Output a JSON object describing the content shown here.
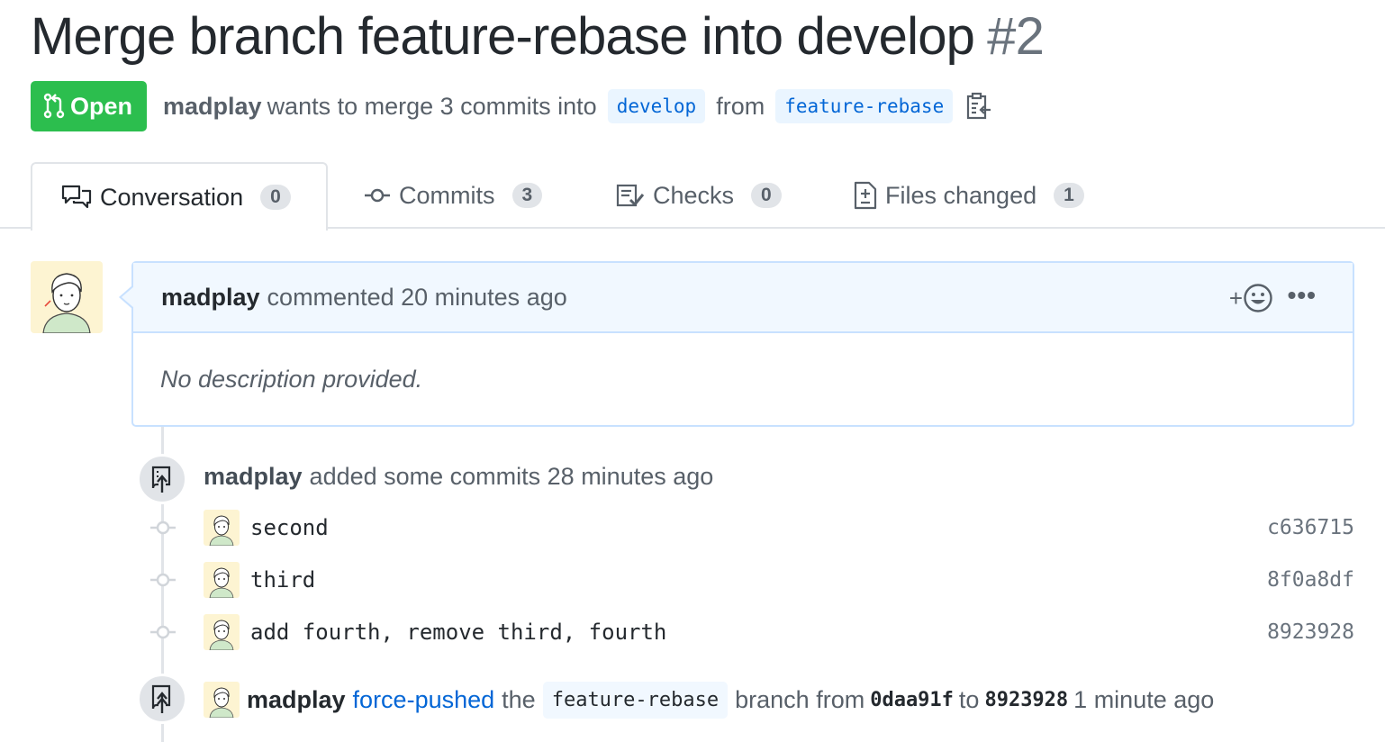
{
  "pr": {
    "title": "Merge branch feature-rebase into develop",
    "number": "#2",
    "state": "Open",
    "author": "madplay",
    "merge_text_1": "wants to merge 3 commits into",
    "base_branch": "develop",
    "merge_text_2": "from",
    "head_branch": "feature-rebase"
  },
  "tabs": [
    {
      "label": "Conversation",
      "count": "0",
      "icon": "comment-discussion-icon"
    },
    {
      "label": "Commits",
      "count": "3",
      "icon": "git-commit-icon"
    },
    {
      "label": "Checks",
      "count": "0",
      "icon": "checklist-icon"
    },
    {
      "label": "Files changed",
      "count": "1",
      "icon": "file-diff-icon"
    }
  ],
  "comment": {
    "author": "madplay",
    "action": "commented 20 minutes ago",
    "reaction_plus": "+",
    "more": "•••",
    "body": "No description provided."
  },
  "commits_event": {
    "author": "madplay",
    "text": "added some commits 28 minutes ago",
    "commits": [
      {
        "message": "second",
        "sha": "c636715"
      },
      {
        "message": "third",
        "sha": "8f0a8df"
      },
      {
        "message": "add fourth, remove third, fourth",
        "sha": "8923928"
      }
    ]
  },
  "force_push": {
    "author": "madplay",
    "link": "force-pushed",
    "text_1": "the",
    "branch": "feature-rebase",
    "text_2": "branch from",
    "from_sha": "0daa91f",
    "text_3": "to",
    "to_sha": "8923928",
    "time": "1 minute ago"
  },
  "colors": {
    "open_green": "#2cbe4e",
    "link_blue": "#0366d6",
    "comment_header_bg": "#f1f8ff",
    "comment_border": "#c8e1ff"
  }
}
